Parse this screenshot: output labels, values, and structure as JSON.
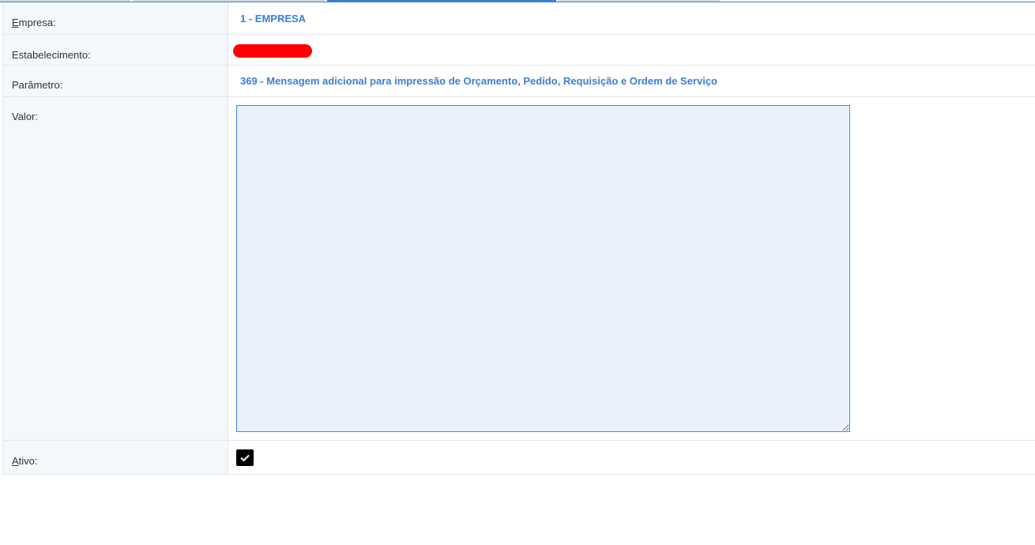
{
  "colors": {
    "accent": "#3b7ed4",
    "label_bg": "#f4f7fb",
    "textarea_bg": "#e9f1fb",
    "redaction": "#ff0000"
  },
  "form": {
    "empresa": {
      "label_first": "E",
      "label_rest": "mpresa:",
      "value": "1 - EMPRESA"
    },
    "estabelecimento": {
      "label": "Estabelecimento:"
    },
    "parametro": {
      "label": "Parâmetro:",
      "value": "369 - Mensagem adicional para impressão de Orçamento, Pedido, Requisição e Ordem de Serviço"
    },
    "valor": {
      "label": "Valor:",
      "value": ""
    },
    "ativo": {
      "label_first": "A",
      "label_rest": "tivo:",
      "checked": true
    }
  }
}
